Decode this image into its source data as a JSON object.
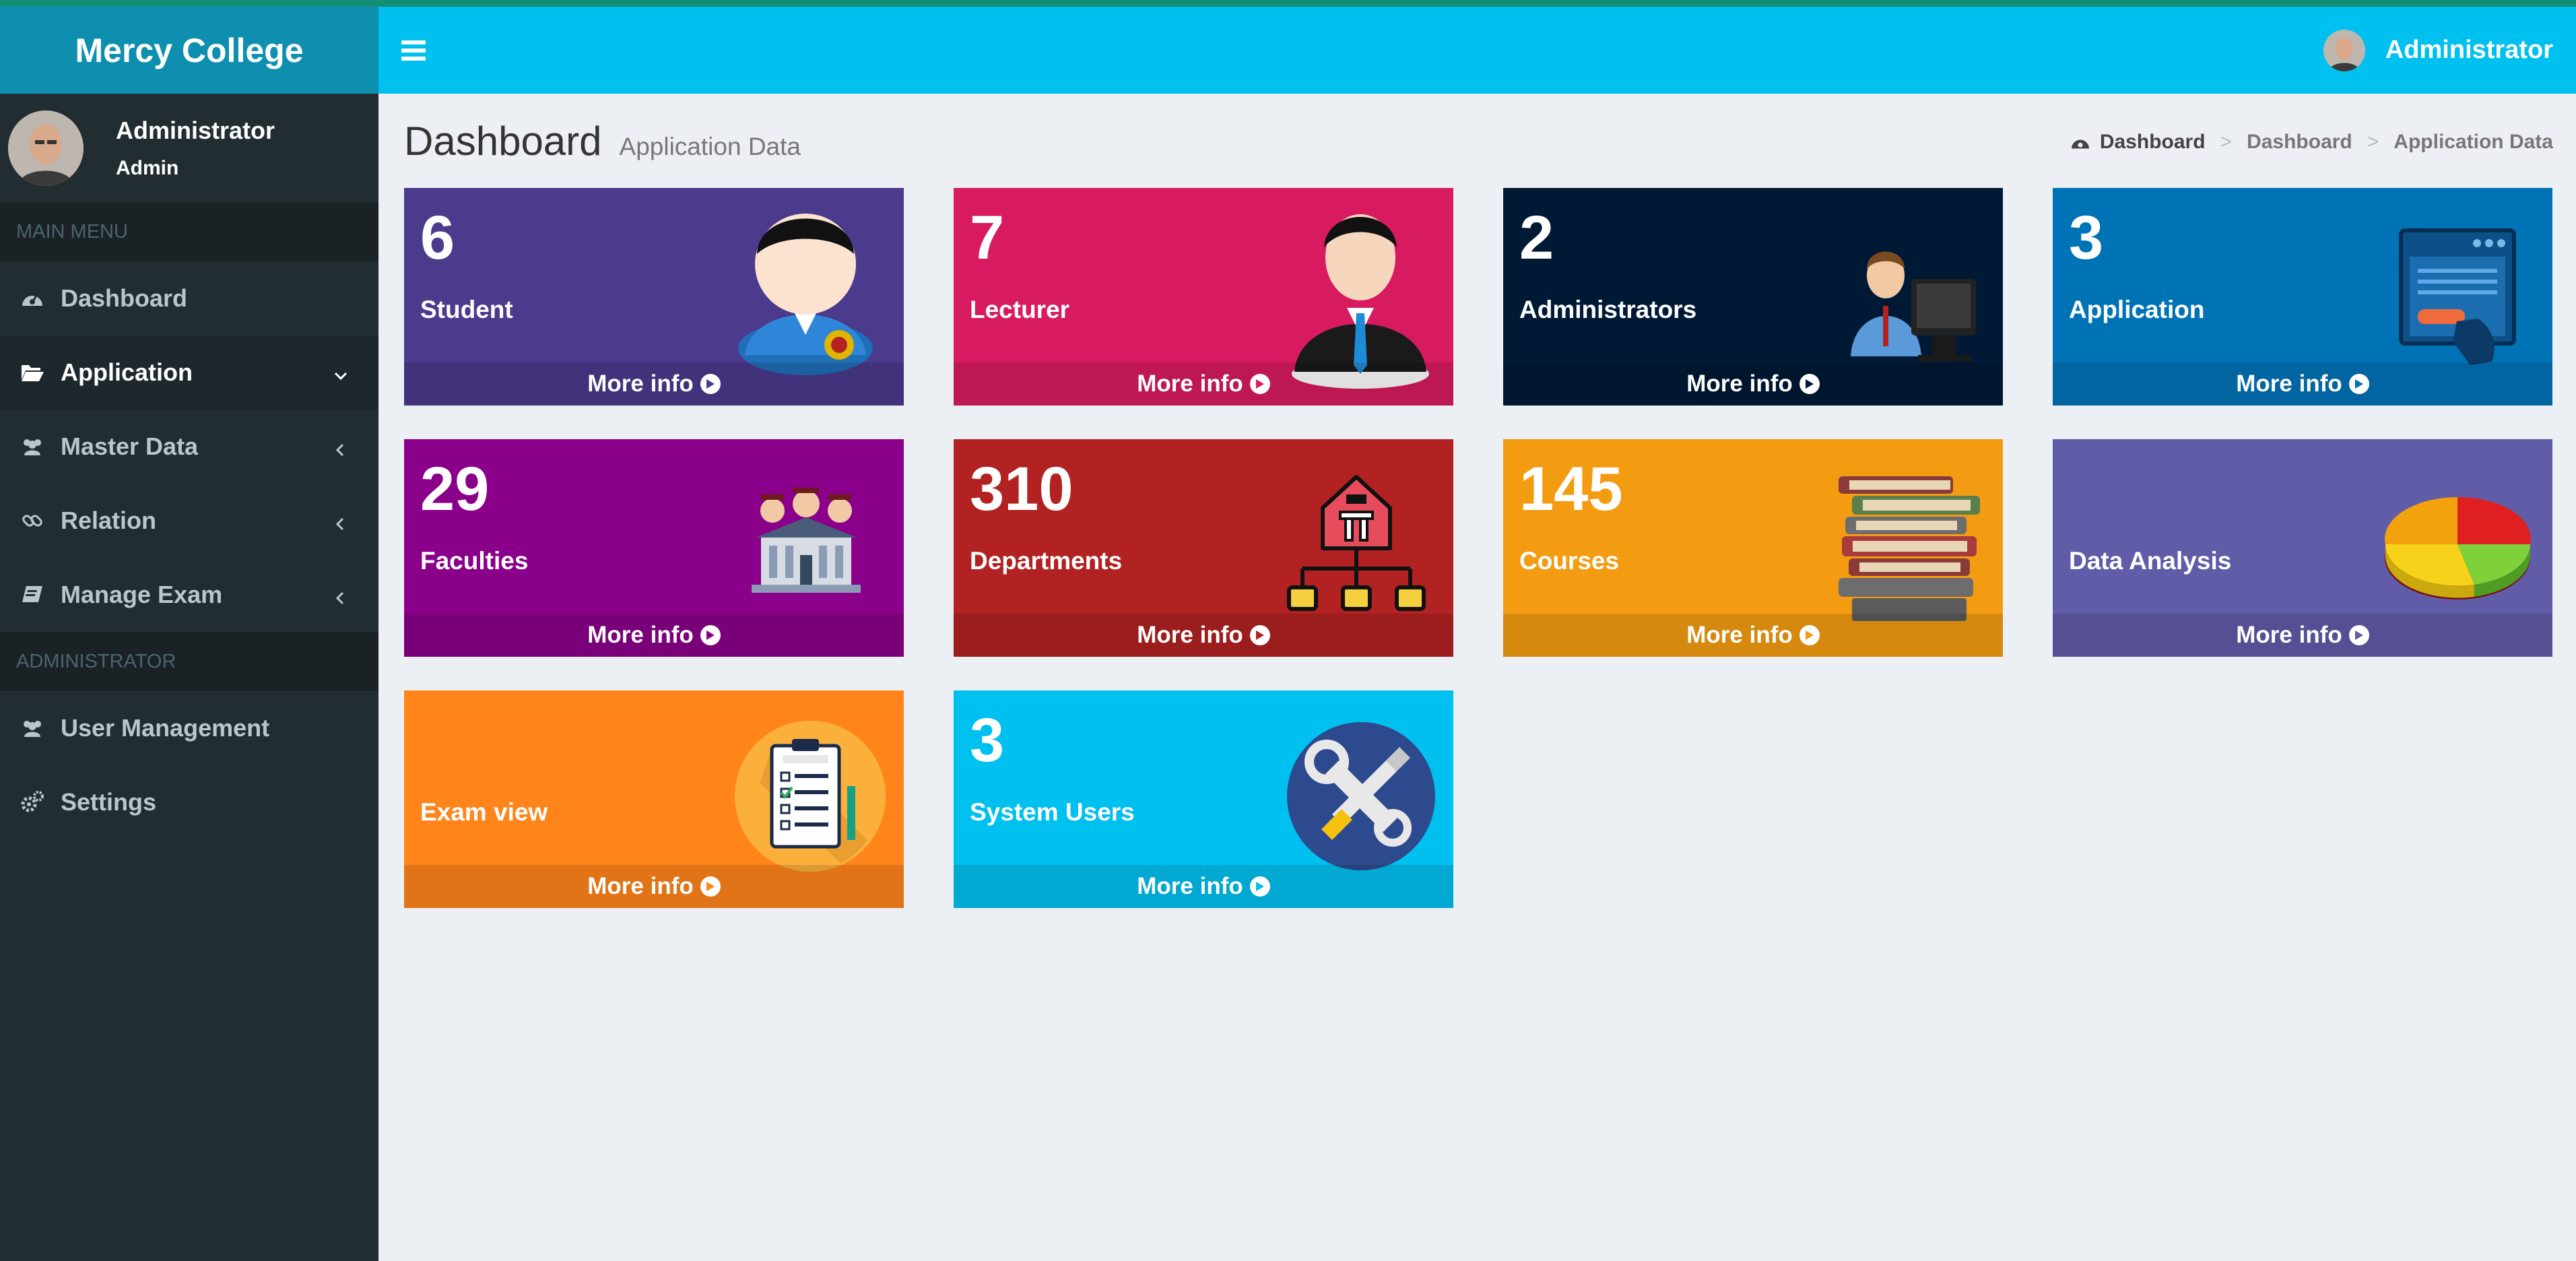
{
  "app": {
    "title": "Mercy College"
  },
  "sidebar": {
    "user": {
      "name": "Administrator",
      "role": "Admin"
    },
    "section_main": "MAIN MENU",
    "section_admin": "ADMINISTRATOR",
    "items": [
      {
        "label": "Dashboard",
        "icon": "dashboard-icon"
      },
      {
        "label": "Application",
        "icon": "folder-open-icon",
        "caret": "chevron-down-icon",
        "active": true
      },
      {
        "label": "Master Data",
        "icon": "users-icon",
        "caret": "chevron-left-icon"
      },
      {
        "label": "Relation",
        "icon": "link-icon",
        "caret": "chevron-left-icon"
      },
      {
        "label": "Manage Exam",
        "icon": "book-icon",
        "caret": "chevron-left-icon"
      }
    ],
    "admin_items": [
      {
        "label": "User Management",
        "icon": "users-icon"
      },
      {
        "label": "Settings",
        "icon": "gears-icon"
      }
    ]
  },
  "header": {
    "user_name": "Administrator"
  },
  "page": {
    "title": "Dashboard",
    "subtitle": "Application Data",
    "breadcrumb": [
      "Dashboard",
      "Dashboard",
      "Application Data"
    ]
  },
  "boxes": [
    {
      "count": "6",
      "label": "Student",
      "more": "More info",
      "color": "#4c3a8c",
      "icon": "student-icon"
    },
    {
      "count": "7",
      "label": "Lecturer",
      "more": "More info",
      "color": "#d81b60",
      "icon": "lecturer-icon"
    },
    {
      "count": "2",
      "label": "Administrators",
      "more": "More info",
      "color": "#001a35",
      "icon": "administrator-icon"
    },
    {
      "count": "3",
      "label": "Application",
      "more": "More info",
      "color": "#0073b7",
      "icon": "application-window-icon"
    },
    {
      "count": "29",
      "label": "Faculties",
      "more": "More info",
      "color": "#8b008b",
      "icon": "faculty-building-icon"
    },
    {
      "count": "310",
      "label": "Departments",
      "more": "More info",
      "color": "#b22222",
      "icon": "department-hierarchy-icon"
    },
    {
      "count": "145",
      "label": "Courses",
      "more": "More info",
      "color": "#f39c12",
      "icon": "books-stack-icon"
    },
    {
      "count": "",
      "label": "Data Analysis",
      "more": "More info",
      "color": "#605ca8",
      "icon": "pie-chart-icon"
    },
    {
      "count": "",
      "label": "Exam view",
      "more": "More info",
      "color": "#ff851b",
      "icon": "exam-clipboard-icon"
    },
    {
      "count": "3",
      "label": "System Users",
      "more": "More info",
      "color": "#00c0ef",
      "icon": "tools-icon"
    }
  ]
}
